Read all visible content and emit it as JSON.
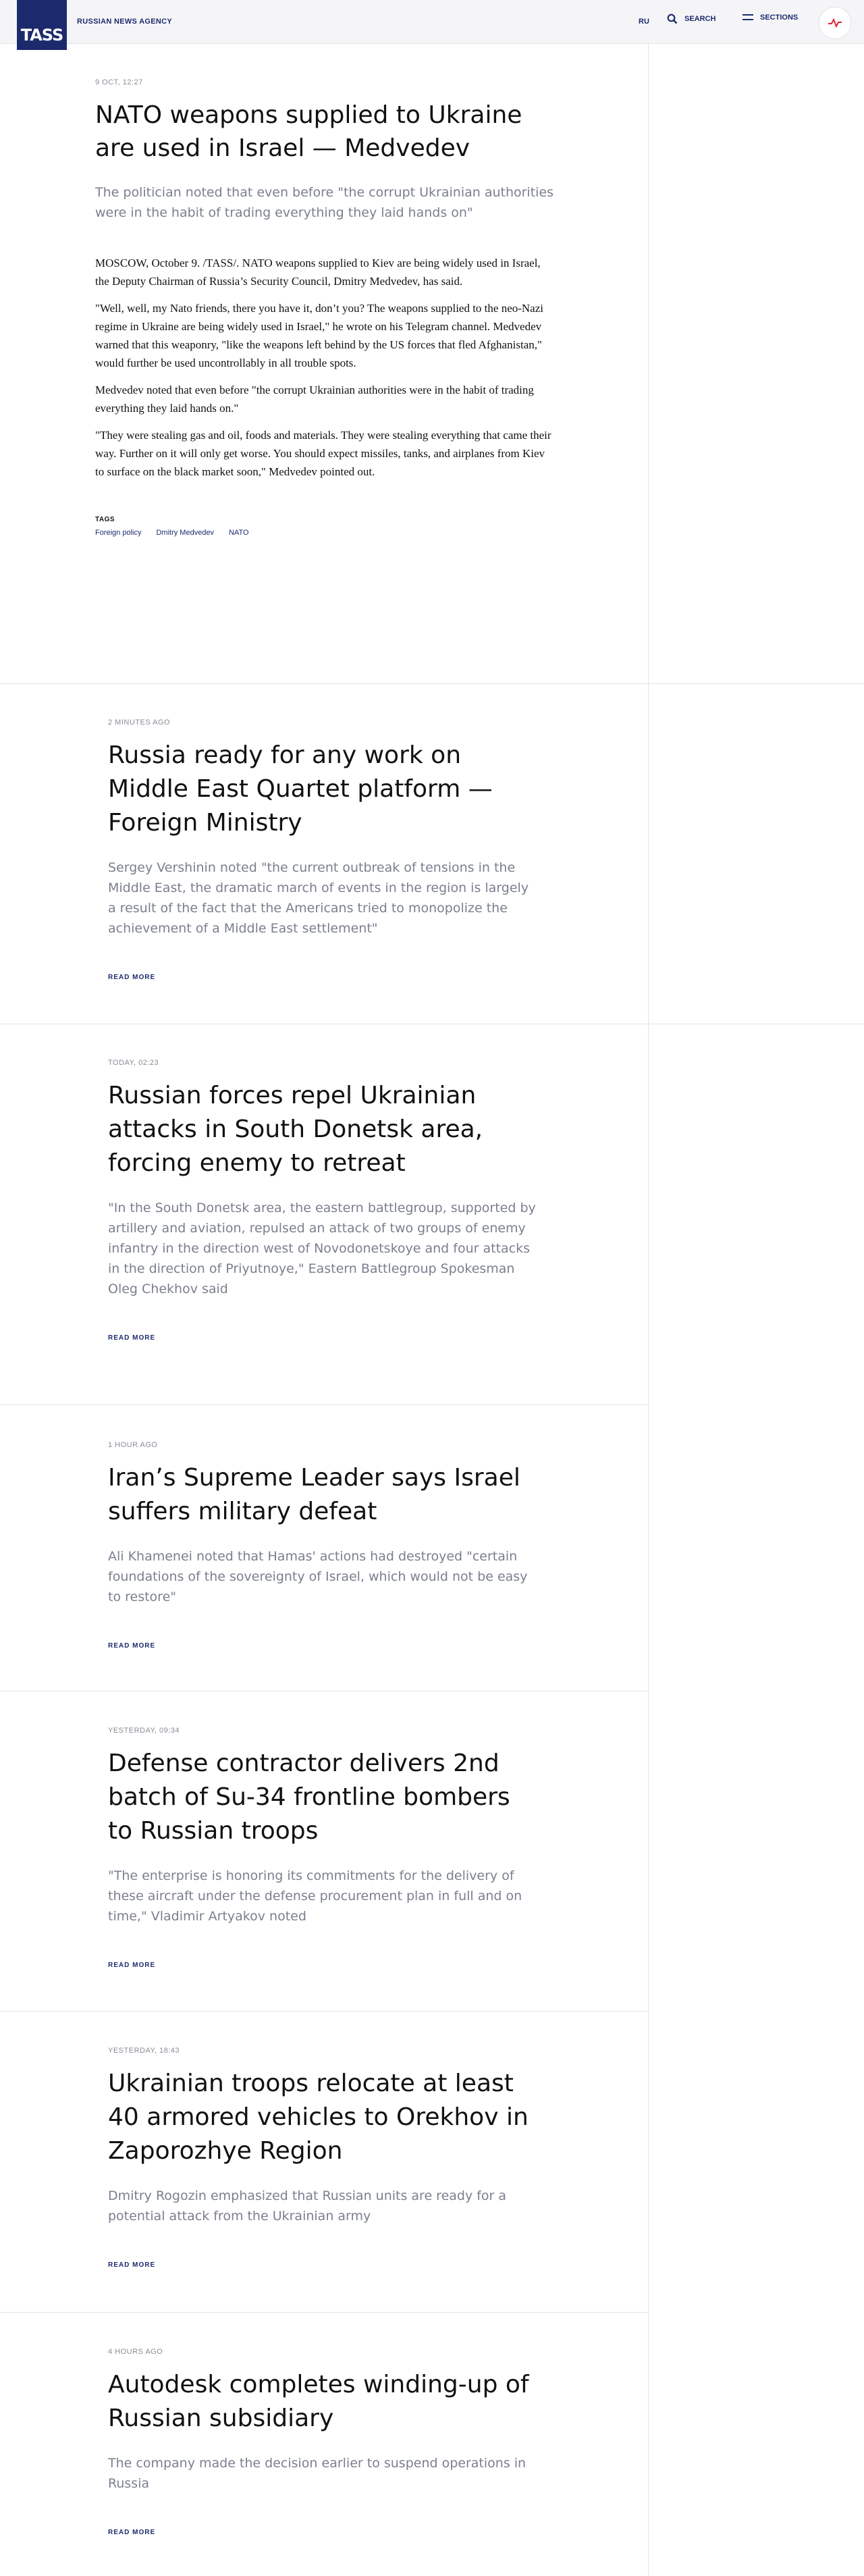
{
  "header": {
    "logo": "TASS",
    "agency": "RUSSIAN NEWS AGENCY",
    "lang": "RU",
    "search": "SEARCH",
    "sections": "SECTIONS"
  },
  "article": {
    "date": "9 OCT, 12:27",
    "title": "NATO weapons supplied to Ukraine are used in Israel — Medvedev",
    "lead": "The politician noted that even before \"the corrupt Ukrainian authorities were in the habit of trading everything they laid hands on\"",
    "paragraphs": [
      "MOSCOW, October 9. /TASS/. NATO weapons supplied to Kiev are being widely used in Israel, the Deputy Chairman of Russia’s Security Council, Dmitry Medvedev, has said.",
      "\"Well, well, my Nato friends, there you have it, don’t you? The weapons supplied to the neo-Nazi regime in Ukraine are being widely used in Israel,\" he wrote on his Telegram channel. Medvedev warned that this weaponry, \"like the weapons left behind by the US forces that fled Afghanistan,\" would further be used uncontrollably in all trouble spots.",
      "Medvedev noted that even before \"the corrupt Ukrainian authorities were in the habit of trading everything they laid hands on.\"",
      "\"They were stealing gas and oil, foods and materials. They were stealing everything that came their way. Further on it will only get worse. You should expect missiles, tanks, and airplanes from Kiev to surface on the black market soon,\" Medvedev pointed out."
    ],
    "tags_label": "TAGS",
    "tags": [
      "Foreign policy",
      "Dmitry Medvedev",
      "NATO"
    ]
  },
  "cards": [
    {
      "time": "2 MINUTES AGO",
      "title": "Russia ready for any work on Middle East Quartet platform — Foreign Ministry",
      "lead": "Sergey Vershinin noted \"the current outbreak of tensions in the Middle East, the dramatic march of events in the region is largely a result of the fact that the Americans tried to monopolize the achievement of a Middle East settlement\"",
      "read_more": "READ MORE"
    },
    {
      "time": "TODAY, 02:23",
      "title": "Russian forces repel Ukrainian attacks in South Donetsk area, forcing enemy to retreat",
      "lead": "\"In the South Donetsk area, the eastern battlegroup, supported by artillery and aviation, repulsed an attack of two groups of enemy infantry in the direction west of Novodonetskoye and four attacks in the direction of Priyutnoye,\" Eastern Battlegroup Spokesman Oleg Chekhov said",
      "read_more": "READ MORE"
    },
    {
      "time": "1 HOUR AGO",
      "title": "Iran’s Supreme Leader says Israel suffers military defeat",
      "lead": "Ali Khamenei noted that Hamas' actions had destroyed \"certain foundations of the sovereignty of Israel, which would not be easy to restore\"",
      "read_more": "READ MORE"
    },
    {
      "time": "YESTERDAY, 09:34",
      "title": "Defense contractor delivers 2nd batch of Su-34 frontline bombers to Russian troops",
      "lead": "\"The enterprise is honoring its commitments for the delivery of these aircraft under the defense procurement plan in full and on time,\" Vladimir Artyakov noted",
      "read_more": "READ MORE"
    },
    {
      "time": "YESTERDAY, 18:43",
      "title": "Ukrainian troops relocate at least 40 armored vehicles to Orekhov in Zaporozhye Region",
      "lead": "Dmitry Rogozin emphasized that Russian units are ready for a potential attack from the Ukrainian army",
      "read_more": "READ MORE"
    },
    {
      "time": "4 HOURS AGO",
      "title": "Autodesk completes winding-up of Russian subsidiary",
      "lead": "The company made the decision earlier to suspend operations in Russia",
      "read_more": "READ MORE"
    }
  ]
}
